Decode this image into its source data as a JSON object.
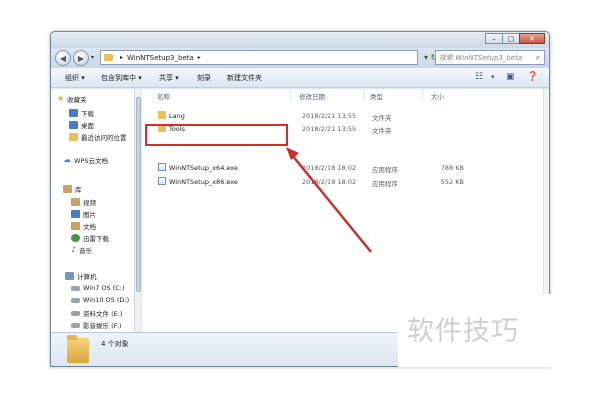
{
  "address": {
    "path": [
      "WinNTSetup3_beta"
    ],
    "search_placeholder": "搜索 WinNTSetup3_beta"
  },
  "toolbar": {
    "organize": "组织 ▾",
    "include_in_library": "包含到库中 ▾",
    "share": "共享 ▾",
    "burn": "刻录",
    "new_folder": "新建文件夹"
  },
  "sidebar": {
    "favorites": {
      "label": "收藏夹",
      "items": [
        {
          "label": "下载",
          "icon": "downloads-icon"
        },
        {
          "label": "桌面",
          "icon": "desktop-icon"
        },
        {
          "label": "最近访问的位置",
          "icon": "recent-places-icon"
        }
      ]
    },
    "wps": {
      "label": "WPS云文档",
      "icon": "cloud-icon"
    },
    "libraries": {
      "label": "库",
      "items": [
        {
          "label": "视频",
          "icon": "video-icon"
        },
        {
          "label": "图片",
          "icon": "pictures-icon"
        },
        {
          "label": "文档",
          "icon": "documents-icon"
        },
        {
          "label": "迅雷下载",
          "icon": "thunder-download-icon"
        },
        {
          "label": "音乐",
          "icon": "music-icon"
        }
      ]
    },
    "computer": {
      "label": "计算机",
      "items": [
        {
          "label": "Win7 OS (C:)",
          "icon": "drive-icon"
        },
        {
          "label": "Win10 OS (D:)",
          "icon": "drive-icon"
        },
        {
          "label": "资料文件 (E:)",
          "icon": "drive-icon"
        },
        {
          "label": "影音娱乐 (F:)",
          "icon": "drive-icon"
        }
      ]
    }
  },
  "columns": {
    "name": "名称",
    "date": "修改日期",
    "type": "类型",
    "size": "大小"
  },
  "files": [
    {
      "name": "Lang",
      "date": "2018/2/21 13:55",
      "type": "文件夹",
      "size": "",
      "icon": "folder-icon"
    },
    {
      "name": "Tools",
      "date": "2018/2/21 13:55",
      "type": "文件夹",
      "size": "",
      "icon": "folder-icon"
    },
    {
      "name": "WinNTSetup_x64.exe",
      "date": "2018/2/18 18:02",
      "type": "应用程序",
      "size": "788 KB",
      "icon": "exe-icon",
      "highlighted": true
    },
    {
      "name": "WinNTSetup_x86.exe",
      "date": "2018/2/18 18:02",
      "type": "应用程序",
      "size": "552 KB",
      "icon": "exe-icon"
    }
  ],
  "status": {
    "count": "4 个对象"
  },
  "watermark": {
    "text": "软件技巧"
  },
  "colors": {
    "highlight": "#d52c2c",
    "folder": "#e9c15b",
    "window_chrome": "#dfe8f2"
  }
}
